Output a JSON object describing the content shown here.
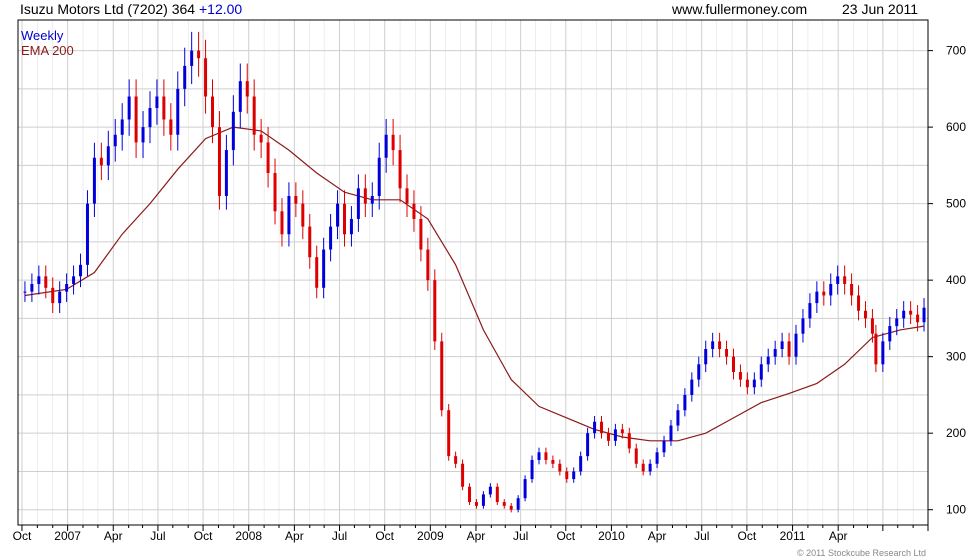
{
  "header": {
    "title": "Isuzu Motors Ltd (7202) 364",
    "change": "+12.00",
    "site": "www.fullermoney.com",
    "date": "23 Jun 2011"
  },
  "legend": {
    "weekly": "Weekly",
    "ema": "EMA 200"
  },
  "footer": {
    "copyright": "© 2011 Stockcube Research Ltd"
  },
  "colors": {
    "up": "#0000dd",
    "down": "#dd0000",
    "ema": "#8b1a1a",
    "grid": "#cfcfcf",
    "axis": "#000000"
  },
  "chart_data": {
    "type": "line",
    "series": [
      {
        "name": "Weekly",
        "style": "candlestick-approx",
        "x": [
          "2006-07-07",
          "2006-07-21",
          "2006-08-04",
          "2006-08-18",
          "2006-09-01",
          "2006-09-15",
          "2006-09-29",
          "2006-10-13",
          "2006-10-27",
          "2006-11-10",
          "2006-11-24",
          "2006-12-08",
          "2006-12-22",
          "2007-01-05",
          "2007-01-19",
          "2007-02-02",
          "2007-02-16",
          "2007-03-02",
          "2007-03-16",
          "2007-03-30",
          "2007-04-13",
          "2007-04-27",
          "2007-05-11",
          "2007-05-25",
          "2007-06-08",
          "2007-06-22",
          "2007-07-06",
          "2007-07-20",
          "2007-08-03",
          "2007-08-17",
          "2007-08-31",
          "2007-09-14",
          "2007-09-28",
          "2007-10-12",
          "2007-10-26",
          "2007-11-09",
          "2007-11-23",
          "2007-12-07",
          "2007-12-21",
          "2008-01-04",
          "2008-01-18",
          "2008-02-01",
          "2008-02-15",
          "2008-02-29",
          "2008-03-14",
          "2008-03-28",
          "2008-04-11",
          "2008-04-25",
          "2008-05-09",
          "2008-05-23",
          "2008-06-06",
          "2008-06-20",
          "2008-07-04",
          "2008-07-18",
          "2008-08-01",
          "2008-08-15",
          "2008-08-29",
          "2008-09-12",
          "2008-09-26",
          "2008-10-10",
          "2008-10-24",
          "2008-11-07",
          "2008-11-21",
          "2008-12-05",
          "2008-12-19",
          "2009-01-02",
          "2009-01-16",
          "2009-01-30",
          "2009-02-13",
          "2009-02-27",
          "2009-03-13",
          "2009-03-27",
          "2009-04-10",
          "2009-04-24",
          "2009-05-08",
          "2009-05-22",
          "2009-06-05",
          "2009-06-19",
          "2009-07-03",
          "2009-07-17",
          "2009-07-31",
          "2009-08-14",
          "2009-08-28",
          "2009-09-11",
          "2009-09-25",
          "2009-10-09",
          "2009-10-23",
          "2009-11-06",
          "2009-11-20",
          "2009-12-04",
          "2009-12-18",
          "2010-01-01",
          "2010-01-15",
          "2010-01-29",
          "2010-02-12",
          "2010-02-26",
          "2010-03-12",
          "2010-03-26",
          "2010-04-09",
          "2010-04-23",
          "2010-05-07",
          "2010-05-21",
          "2010-06-04",
          "2010-06-18",
          "2010-07-02",
          "2010-07-16",
          "2010-07-30",
          "2010-08-13",
          "2010-08-27",
          "2010-09-10",
          "2010-09-24",
          "2010-10-08",
          "2010-10-22",
          "2010-11-05",
          "2010-11-19",
          "2010-12-03",
          "2010-12-17",
          "2010-12-31",
          "2011-01-14",
          "2011-01-28",
          "2011-02-11",
          "2011-02-25",
          "2011-03-11",
          "2011-03-18",
          "2011-04-01",
          "2011-04-15",
          "2011-04-29",
          "2011-05-13",
          "2011-05-27",
          "2011-06-10",
          "2011-06-23"
        ],
        "values": [
          385,
          395,
          405,
          390,
          370,
          385,
          395,
          405,
          420,
          500,
          560,
          550,
          575,
          590,
          610,
          640,
          580,
          600,
          625,
          640,
          610,
          590,
          650,
          680,
          700,
          690,
          640,
          600,
          510,
          570,
          620,
          660,
          640,
          590,
          580,
          540,
          490,
          460,
          510,
          500,
          470,
          430,
          390,
          440,
          470,
          500,
          460,
          480,
          520,
          500,
          510,
          560,
          590,
          570,
          520,
          500,
          480,
          440,
          400,
          320,
          230,
          170,
          160,
          130,
          110,
          105,
          120,
          130,
          110,
          105,
          100,
          115,
          140,
          165,
          175,
          165,
          160,
          150,
          140,
          150,
          170,
          200,
          215,
          200,
          190,
          205,
          200,
          180,
          160,
          150,
          160,
          175,
          190,
          210,
          230,
          250,
          270,
          290,
          310,
          320,
          310,
          300,
          280,
          270,
          260,
          270,
          290,
          300,
          310,
          320,
          300,
          330,
          350,
          370,
          385,
          380,
          395,
          405,
          395,
          380,
          360,
          350,
          330,
          290,
          320,
          340,
          350,
          360,
          355,
          345,
          364
        ],
        "ylim": [
          80,
          740
        ]
      },
      {
        "name": "EMA 200",
        "x": [
          "2006-07-07",
          "2006-09-29",
          "2006-11-24",
          "2007-01-19",
          "2007-03-16",
          "2007-05-11",
          "2007-07-06",
          "2007-08-31",
          "2007-10-26",
          "2007-12-21",
          "2008-02-15",
          "2008-04-11",
          "2008-06-06",
          "2008-08-01",
          "2008-09-26",
          "2008-11-21",
          "2009-01-16",
          "2009-03-13",
          "2009-05-08",
          "2009-07-03",
          "2009-08-28",
          "2009-10-23",
          "2009-12-18",
          "2010-02-12",
          "2010-04-09",
          "2010-06-04",
          "2010-07-30",
          "2010-09-24",
          "2010-11-19",
          "2011-01-14",
          "2011-03-11",
          "2011-05-06",
          "2011-06-23"
        ],
        "values": [
          380,
          388,
          410,
          460,
          500,
          545,
          585,
          600,
          595,
          570,
          540,
          515,
          505,
          505,
          480,
          420,
          335,
          270,
          235,
          220,
          205,
          195,
          190,
          190,
          200,
          220,
          240,
          252,
          265,
          290,
          325,
          335,
          340
        ]
      }
    ],
    "x_ticks": [
      "Oct",
      "2007",
      "Apr",
      "Jul",
      "Oct",
      "2008",
      "Apr",
      "Jul",
      "Oct",
      "2009",
      "Apr",
      "Jul",
      "Oct",
      "2010",
      "Apr",
      "Jul",
      "Oct",
      "2011",
      "Apr"
    ],
    "y_ticks": [
      100,
      200,
      300,
      400,
      500,
      600,
      700
    ],
    "ylim": [
      80,
      740
    ],
    "grid": true,
    "legend_position": "top-left"
  }
}
